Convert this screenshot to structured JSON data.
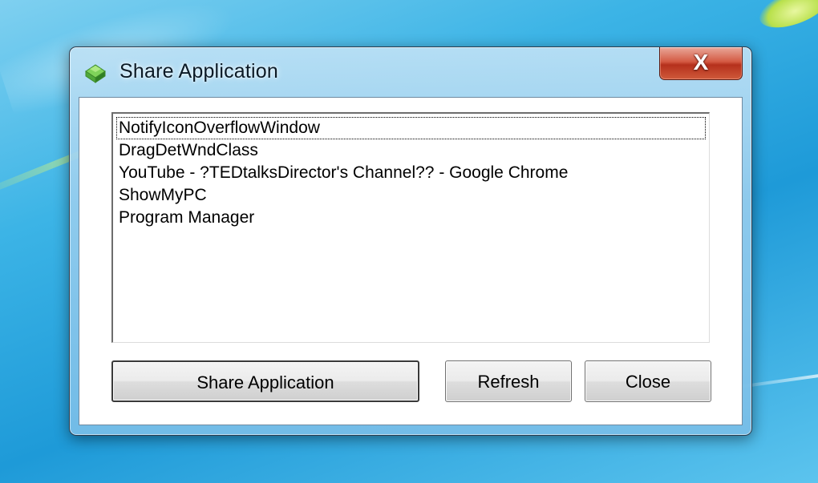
{
  "window": {
    "title": "Share Application",
    "icon": "share-app-icon",
    "close_glyph": "X"
  },
  "listbox": {
    "items": [
      "NotifyIconOverflowWindow",
      "DragDetWndClass",
      "YouTube - ?TEDtalksDirector's Channel?? - Google Chrome",
      "ShowMyPC",
      "Program Manager"
    ],
    "focused_index": 0
  },
  "buttons": {
    "share_label": "Share Application",
    "refresh_label": "Refresh",
    "close_label": "Close"
  },
  "colors": {
    "title_bar_glass": "#96cdee",
    "close_button_red": "#c8402a",
    "desktop_blue": "#2aa8e0"
  }
}
